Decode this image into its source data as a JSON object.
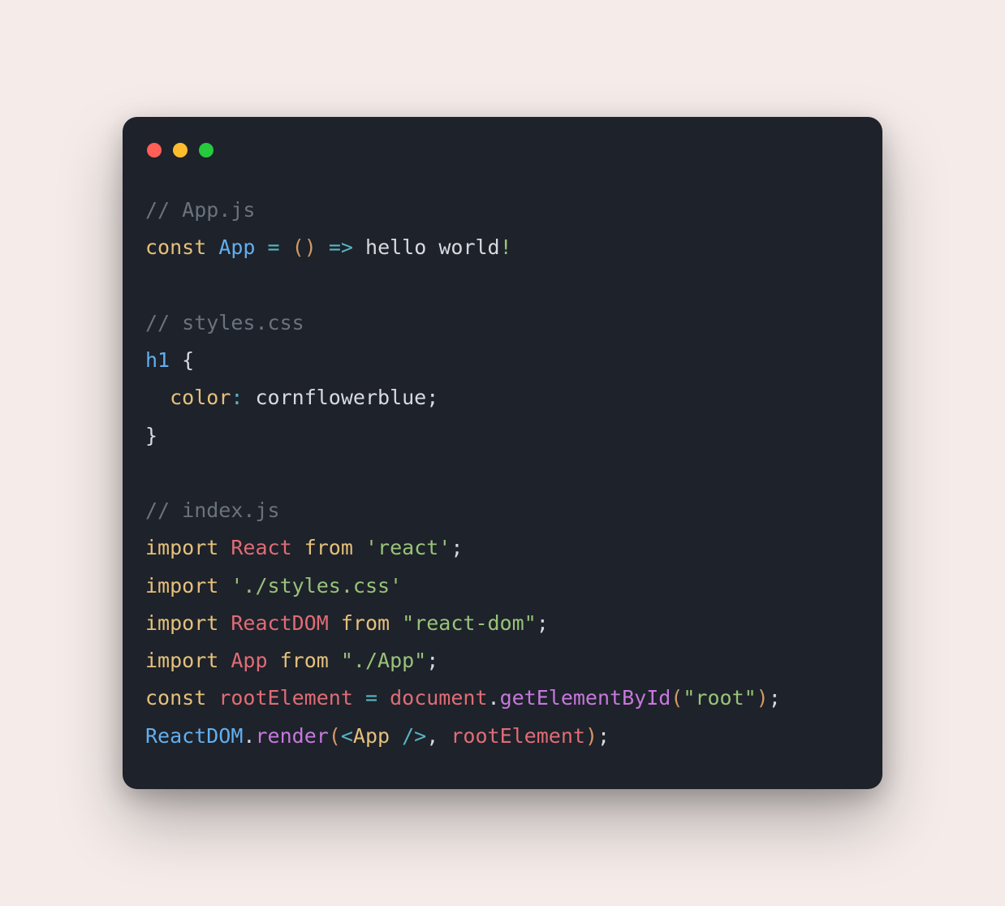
{
  "window": {
    "traffic": {
      "red": "#ff5f56",
      "yellow": "#ffbd2e",
      "green": "#27c93f"
    }
  },
  "code": {
    "l1_comment": "// App.js",
    "l2_const": "const",
    "l2_app": "App",
    "l2_eq": "=",
    "l2_lparen": "(",
    "l2_rparen": ")",
    "l2_arrow": "=>",
    "l2_text": "hello world",
    "l2_excl": "!",
    "l3_blank": "",
    "l4_comment": "// styles.css",
    "l5_sel": "h1",
    "l5_brace": "{",
    "l6_prop": "color",
    "l6_colon": ":",
    "l6_value": "cornflowerblue",
    "l6_semi": ";",
    "l7_brace": "}",
    "l8_blank": "",
    "l9_comment": "// index.js",
    "l10_import": "import",
    "l10_ident": "React",
    "l10_from": "from",
    "l10_str": "'react'",
    "l10_semi": ";",
    "l11_import": "import",
    "l11_str": "'./styles.css'",
    "l12_import": "import",
    "l12_ident": "ReactDOM",
    "l12_from": "from",
    "l12_str": "\"react-dom\"",
    "l12_semi": ";",
    "l13_import": "import",
    "l13_ident": "App",
    "l13_from": "from",
    "l13_str": "\"./App\"",
    "l13_semi": ";",
    "l14_const": "const",
    "l14_ident": "rootElement",
    "l14_eq": "=",
    "l14_doc": "document",
    "l14_dot": ".",
    "l14_method": "getElementById",
    "l14_lp": "(",
    "l14_str": "\"root\"",
    "l14_rp": ")",
    "l14_semi": ";",
    "l15_rd": "ReactDOM",
    "l15_dot": ".",
    "l15_method": "render",
    "l15_lp": "(",
    "l15_jsx_lt": "<",
    "l15_jsx_tag": "App",
    "l15_jsx_close": " />",
    "l15_comma": ",",
    "l15_arg": "rootElement",
    "l15_rp": ")",
    "l15_semi": ";"
  }
}
